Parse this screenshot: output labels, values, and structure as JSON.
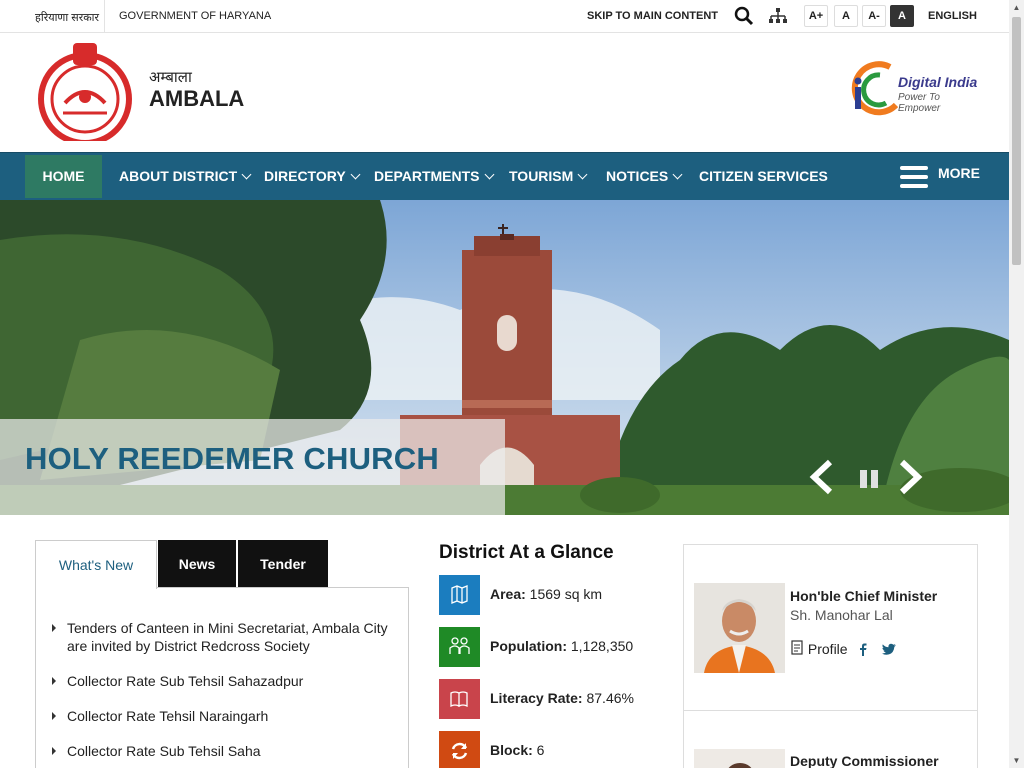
{
  "topbar": {
    "hindi_gov": "हरियाणा सरकार",
    "gov": "GOVERNMENT OF HARYANA",
    "skip": "SKIP TO MAIN CONTENT",
    "font_increase": "A+",
    "font_normal": "A",
    "font_decrease": "A-",
    "contrast": "A",
    "language": "ENGLISH"
  },
  "header": {
    "hindi_name": "अम्बाला",
    "name": "AMBALA",
    "digital_india": "Digital India",
    "tagline": "Power To Empower"
  },
  "nav": {
    "home": "HOME",
    "about": "ABOUT DISTRICT",
    "directory": "DIRECTORY",
    "departments": "DEPARTMENTS",
    "tourism": "TOURISM",
    "notices": "NOTICES",
    "citizen": "CITIZEN SERVICES",
    "more": "MORE"
  },
  "slider": {
    "caption": "HOLY REEDEMER CHURCH"
  },
  "tabs": {
    "whats_new": "What's New",
    "news": "News",
    "tender": "Tender",
    "items": [
      "Tenders of Canteen in Mini Secretariat, Ambala City are invited by District Redcross Society",
      "Collector Rate Sub Tehsil Sahazadpur",
      "Collector Rate Tehsil Naraingarh",
      "Collector Rate Sub Tehsil Saha"
    ]
  },
  "glance": {
    "title": "District At a Glance",
    "stats": [
      {
        "label": "Area:",
        "value": " 1569 sq km",
        "color": "#1b7dbf"
      },
      {
        "label": "Population:",
        "value": " 1,128,350",
        "color": "#1f8a26"
      },
      {
        "label": "Literacy Rate:",
        "value": " 87.46%",
        "color": "#c9444b"
      },
      {
        "label": "Block:",
        "value": " 6",
        "color": "#d04a12"
      }
    ]
  },
  "officials": {
    "cm_role": "Hon'ble Chief Minister",
    "cm_name": "Sh. Manohar Lal",
    "profile": "Profile",
    "dc_role": "Deputy Commissioner"
  }
}
